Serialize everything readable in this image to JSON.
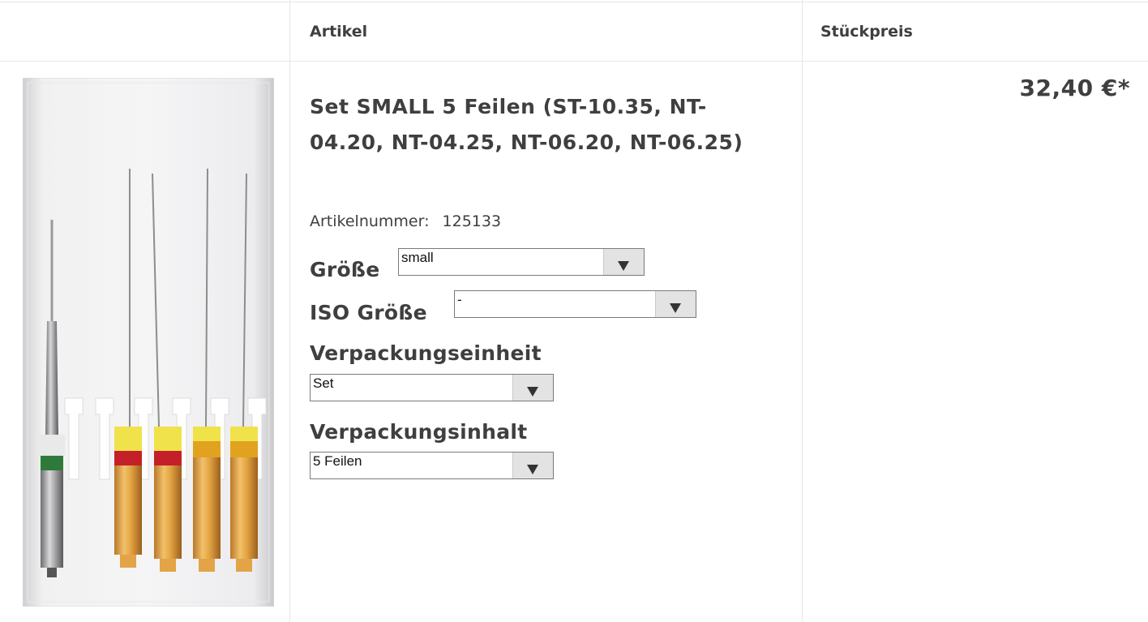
{
  "table": {
    "header": {
      "article": "Artikel",
      "unit_price": "Stückpreis"
    }
  },
  "product": {
    "image_icon": "product-photo-root-canal-files",
    "title": "Set SMALL 5 Feilen (ST-10.35, NT-04.20, NT-04.25, NT-06.20, NT-06.25)",
    "article_number_label": "Artikelnummer:",
    "article_number": "125133",
    "price": "32,40 €*",
    "options": [
      {
        "label": "Größe",
        "value": "small"
      },
      {
        "label": "ISO Größe",
        "value": "-"
      },
      {
        "label": "Verpackungseinheit",
        "value": "Set"
      },
      {
        "label": "Verpackungsinhalt",
        "value": "5 Feilen"
      }
    ]
  },
  "colors": {
    "border": "#e6e6e6",
    "text": "#3f3f3f",
    "select_arrow_bg": "#e3e3e3"
  }
}
